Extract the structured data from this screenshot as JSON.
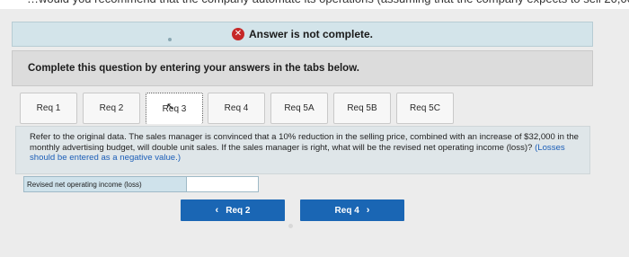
{
  "banner": {
    "status_text": "Answer is not complete."
  },
  "instruction": "Complete this question by entering your answers in the tabs below.",
  "tabs": [
    {
      "label": "Req 1"
    },
    {
      "label": "Req 2"
    },
    {
      "label": "Req 3"
    },
    {
      "label": "Req 4"
    },
    {
      "label": "Req 5A"
    },
    {
      "label": "Req 5B"
    },
    {
      "label": "Req 5C"
    }
  ],
  "active_tab": "Req 3",
  "question": {
    "text": "Refer to the original data. The sales manager is convinced that a 10% reduction in the selling price, combined with an increase of $32,000 in the monthly advertising budget, will double unit sales. If the sales manager is right, what will be the revised net operating income (loss)? ",
    "hint": "(Losses should be entered as a negative value.)"
  },
  "answer": {
    "label": "Revised net operating income (loss)",
    "value": ""
  },
  "nav": {
    "prev_label": "Req 2",
    "next_label": "Req 4"
  }
}
